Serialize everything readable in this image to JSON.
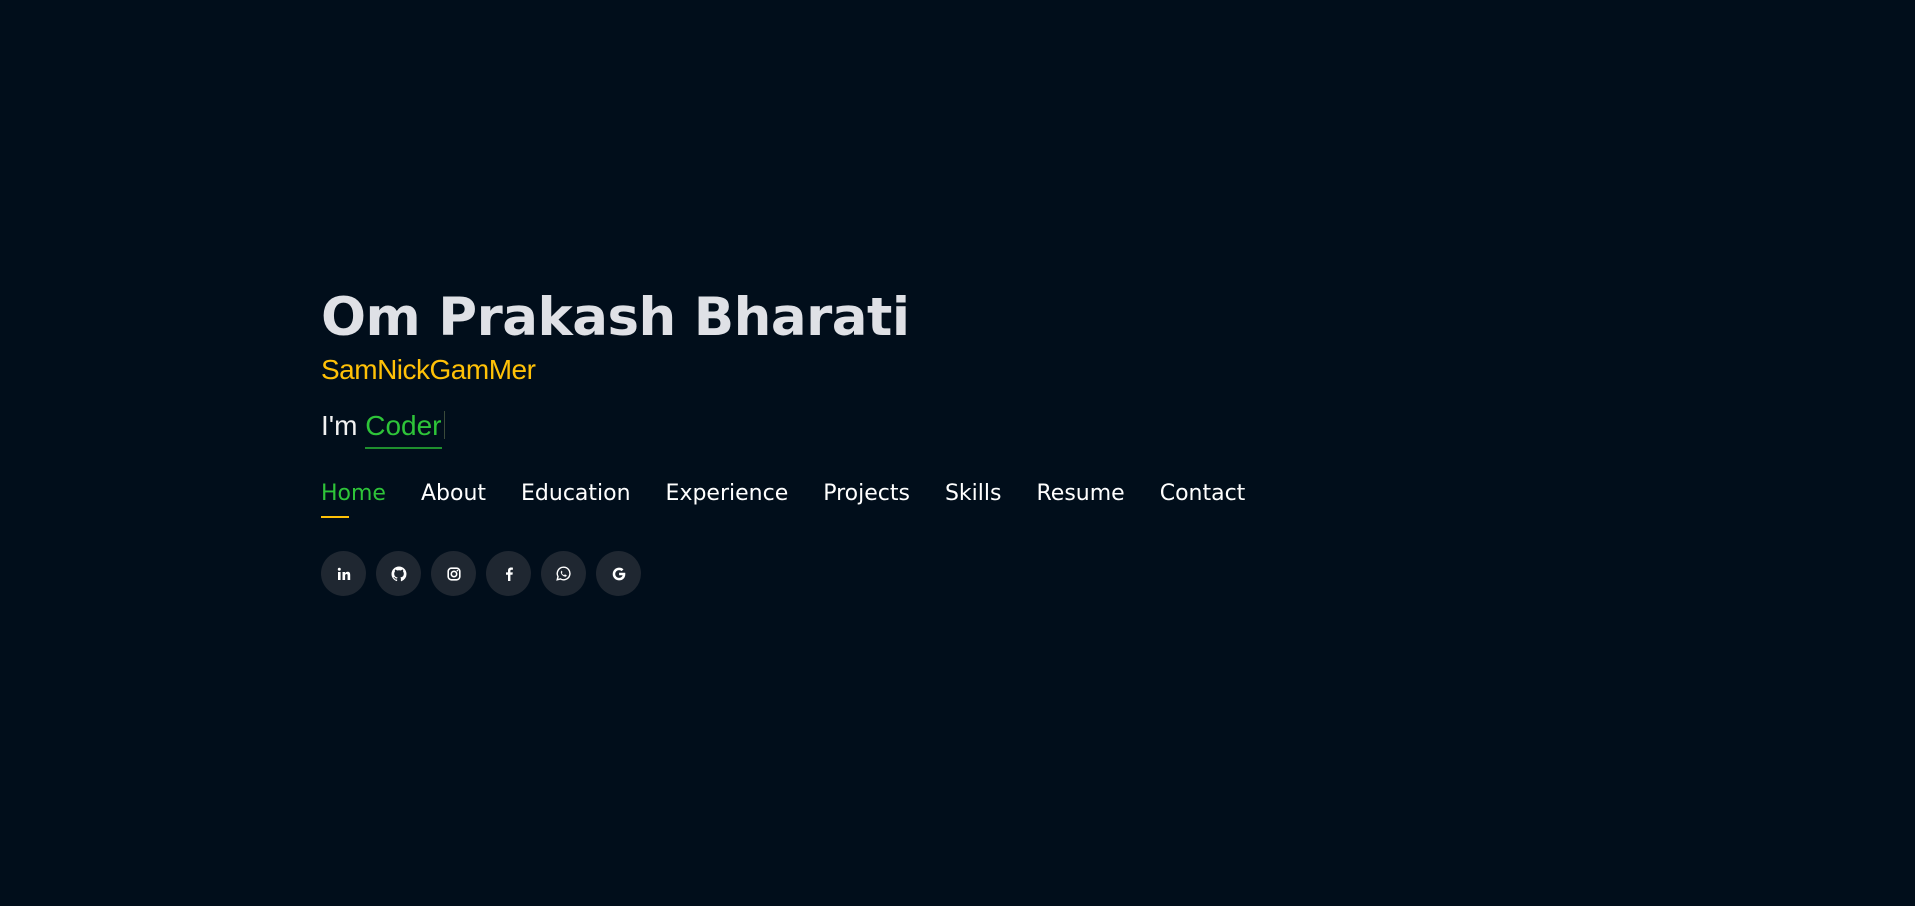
{
  "hero": {
    "name": "Om Prakash Bharati",
    "alias": "SamNickGamMer",
    "typed_prefix": "I'm ",
    "typed_word": "Coder"
  },
  "nav": {
    "items": [
      {
        "label": "Home",
        "active": true
      },
      {
        "label": "About",
        "active": false
      },
      {
        "label": "Education",
        "active": false
      },
      {
        "label": "Experience",
        "active": false
      },
      {
        "label": "Projects",
        "active": false
      },
      {
        "label": "Skills",
        "active": false
      },
      {
        "label": "Resume",
        "active": false
      },
      {
        "label": "Contact",
        "active": false
      }
    ]
  },
  "socials": [
    {
      "icon": "linkedin-icon"
    },
    {
      "icon": "github-icon"
    },
    {
      "icon": "instagram-icon"
    },
    {
      "icon": "facebook-icon"
    },
    {
      "icon": "whatsapp-icon"
    },
    {
      "icon": "google-icon"
    }
  ],
  "colors": {
    "background": "#010e1b",
    "name": "#dfe1e6",
    "alias": "#ffc107",
    "accent": "#2ec439",
    "icon_bg": "#1f2731"
  }
}
